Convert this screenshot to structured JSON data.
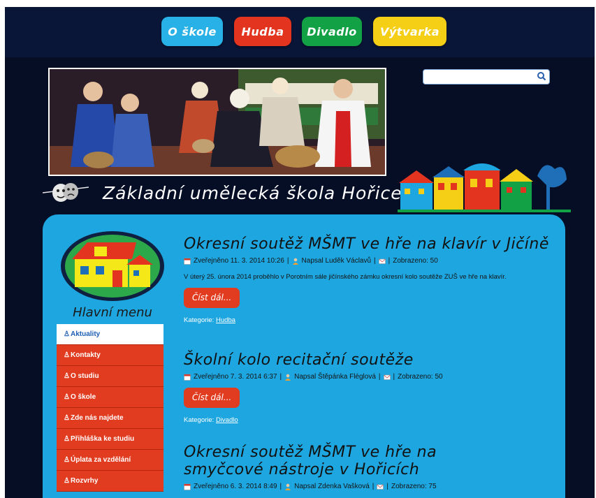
{
  "top_nav": [
    {
      "label": "O škole",
      "color": "#27b1e6"
    },
    {
      "label": "Hudba",
      "color": "#e2341e"
    },
    {
      "label": "Divadlo",
      "color": "#12a144"
    },
    {
      "label": "Výtvarka",
      "color": "#f4cf16"
    }
  ],
  "search": {
    "placeholder": ""
  },
  "site": {
    "title": "Základní umělecká škola Hořice"
  },
  "sidebar": {
    "menu_title": "Hlavní menu",
    "items": [
      {
        "label": "Aktuality",
        "active": true
      },
      {
        "label": "Kontakty"
      },
      {
        "label": "O studiu"
      },
      {
        "label": "O škole"
      },
      {
        "label": "Zde nás najdete"
      },
      {
        "label": "Přihláška ke studiu"
      },
      {
        "label": "Úplata za vzdělání"
      },
      {
        "label": "Rozvrhy"
      }
    ]
  },
  "articles": [
    {
      "title": "Okresní soutěž MŠMT ve hře na klavír v Jičíně",
      "published": "Zveřejněno 11. 3. 2014 10:26",
      "author": "Napsal Luděk Václavů",
      "views": "Zobrazeno: 50",
      "excerpt": "V úterý 25. února 2014 proběhlo v Porotním sále jičínského zámku okresní kolo soutěže ZUŠ ve hře na klavír.",
      "read_more": "Číst dál...",
      "category_label": "Kategorie:",
      "category": "Hudba"
    },
    {
      "title": "Školní kolo recitační soutěže",
      "published": "Zveřejněno 7. 3. 2014 6:37",
      "author": "Napsal Štěpánka Fléglová",
      "views": "Zobrazeno: 50",
      "read_more": "Číst dál...",
      "category_label": "Kategorie:",
      "category": "Divadlo"
    },
    {
      "title": "Okresní soutěž MŠMT ve hře na smyčcové nástroje v Hořicích",
      "published": "Zveřejněno 6. 3. 2014 8:49",
      "author": "Napsal Zdenka Vašková",
      "views": "Zobrazeno: 75"
    }
  ],
  "meta_separator": "|"
}
